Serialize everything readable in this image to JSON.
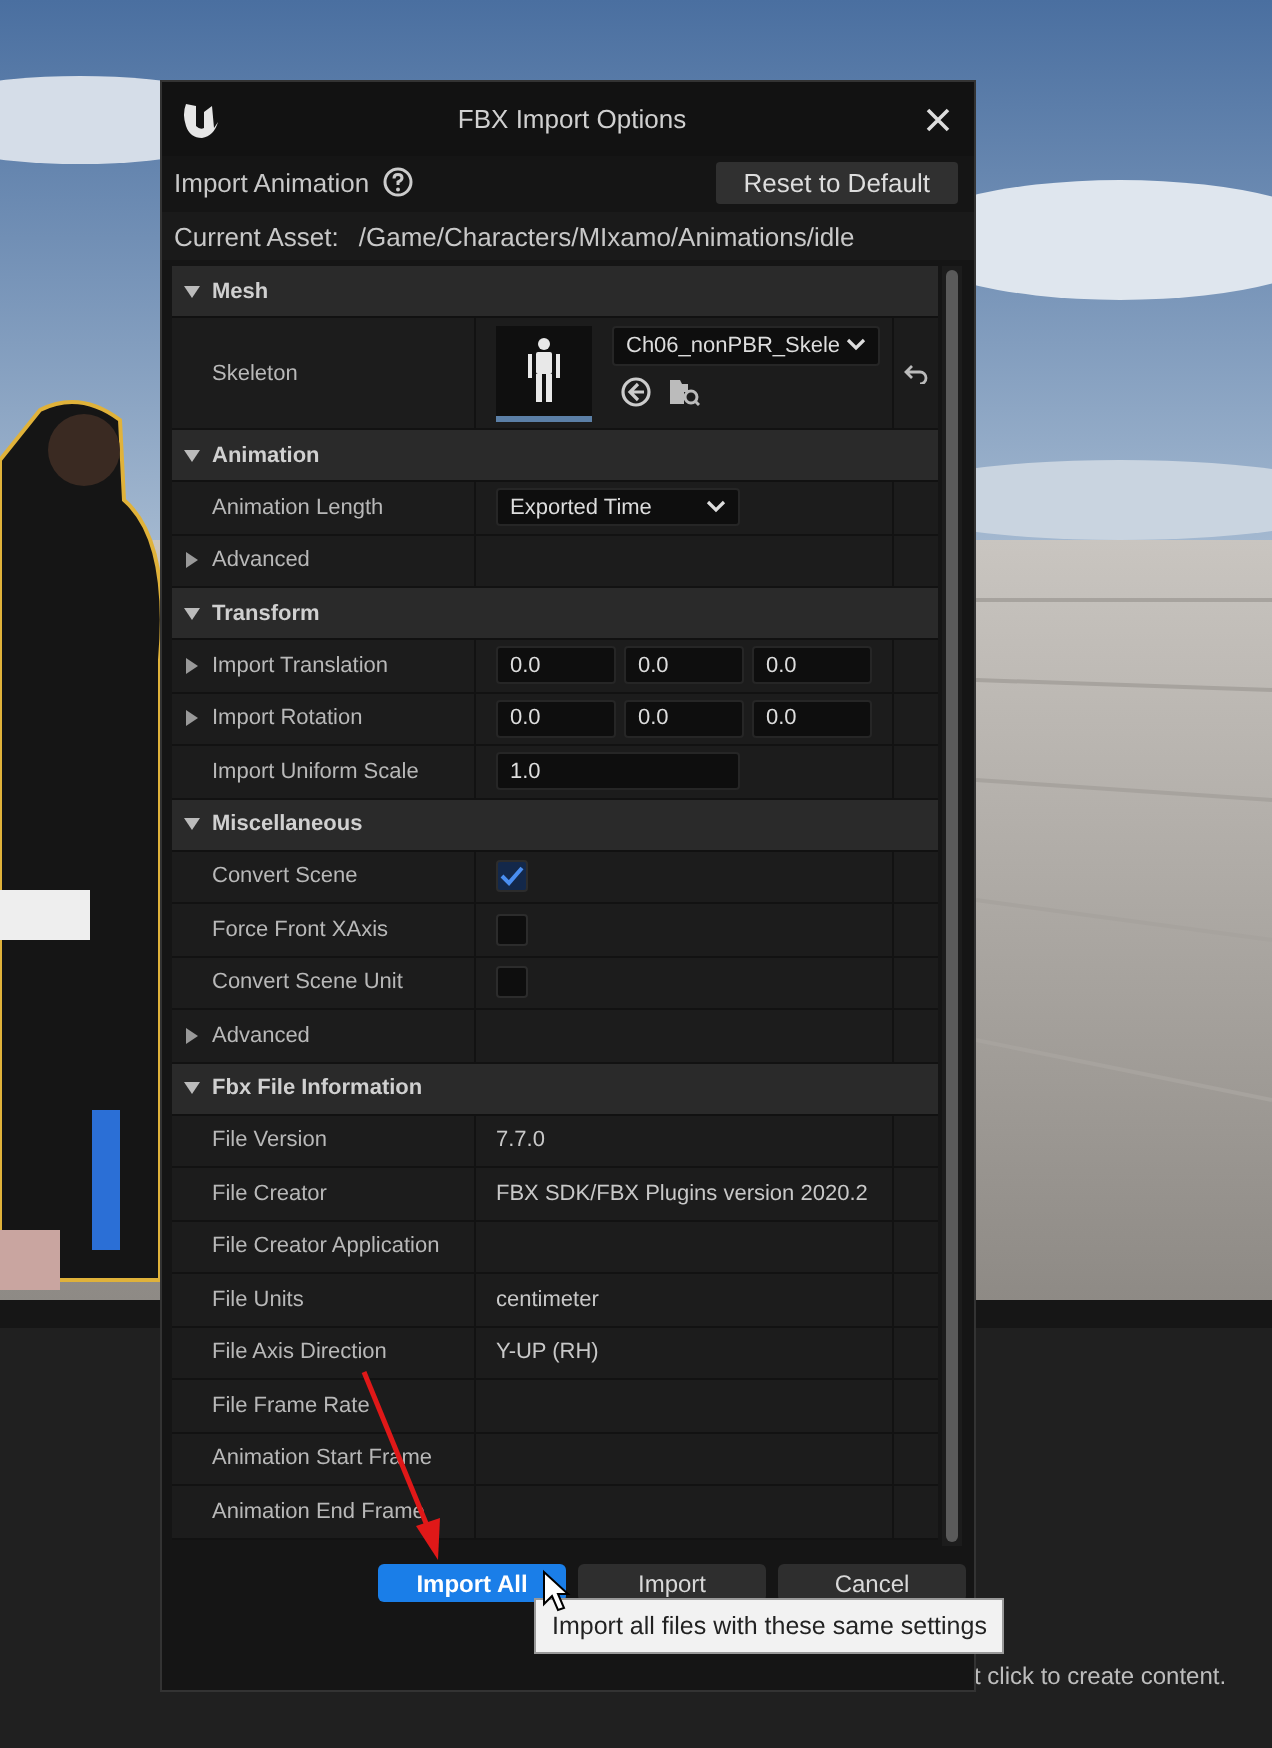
{
  "dialog": {
    "title": "FBX Import Options"
  },
  "header": {
    "label": "Import Animation",
    "reset_button": "Reset to Default"
  },
  "current_asset": {
    "label": "Current Asset:",
    "value": "/Game/Characters/MIxamo/Animations/idle"
  },
  "sections": [
    {
      "title": "Mesh",
      "expanded": true,
      "rows": [
        {
          "kind": "skeleton",
          "label": "Skeleton",
          "value": "Ch06_nonPBR_Skele"
        }
      ]
    },
    {
      "title": "Animation",
      "expanded": true,
      "rows": [
        {
          "kind": "dropdown",
          "label": "Animation Length",
          "value": "Exported Time"
        },
        {
          "kind": "group",
          "label": "Advanced",
          "expanded": false
        }
      ]
    },
    {
      "title": "Transform",
      "expanded": true,
      "rows": [
        {
          "kind": "vector",
          "label": "Import Translation",
          "expanded": false,
          "values": [
            "0.0",
            "0.0",
            "0.0"
          ]
        },
        {
          "kind": "vector",
          "label": "Import Rotation",
          "expanded": false,
          "values": [
            "0.0",
            "0.0",
            "0.0"
          ]
        },
        {
          "kind": "number",
          "label": "Import Uniform Scale",
          "value": "1.0"
        }
      ]
    },
    {
      "title": "Miscellaneous",
      "expanded": true,
      "rows": [
        {
          "kind": "checkbox",
          "label": "Convert Scene",
          "checked": true
        },
        {
          "kind": "checkbox",
          "label": "Force Front XAxis",
          "checked": false
        },
        {
          "kind": "checkbox",
          "label": "Convert Scene Unit",
          "checked": false
        },
        {
          "kind": "group",
          "label": "Advanced",
          "expanded": false
        }
      ]
    },
    {
      "title": "Fbx File Information",
      "expanded": true,
      "rows": [
        {
          "kind": "info",
          "label": "File Version",
          "value": "7.7.0"
        },
        {
          "kind": "info",
          "label": "File Creator",
          "value": "FBX SDK/FBX Plugins version 2020.2"
        },
        {
          "kind": "info",
          "label": "File Creator Application"
        },
        {
          "kind": "info",
          "label": "File Units",
          "value": "centimeter"
        },
        {
          "kind": "info",
          "label": "File Axis Direction",
          "value": "Y-UP (RH)"
        },
        {
          "kind": "info",
          "label": "File Frame Rate"
        },
        {
          "kind": "info",
          "label": "Animation Start Frame"
        },
        {
          "kind": "info",
          "label": "Animation End Frame"
        }
      ]
    }
  ],
  "buttons": [
    {
      "label": "Import All",
      "primary": true
    },
    {
      "label": "Import",
      "primary": false
    },
    {
      "label": "Cancel",
      "primary": false
    }
  ],
  "tooltip": "Import all files with these same settings",
  "viewport_hint": "t click to create content."
}
